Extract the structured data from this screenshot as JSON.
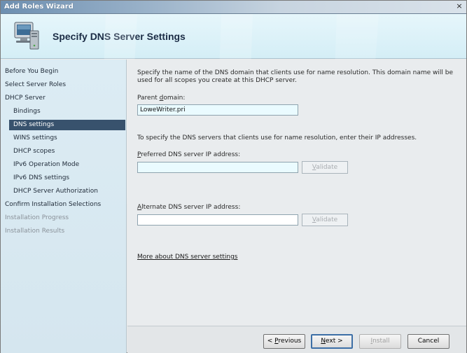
{
  "window": {
    "title": "Add Roles Wizard",
    "close_glyph": "×"
  },
  "header": {
    "title": "Specify DNS Server Settings",
    "icon": "server-computer-icon"
  },
  "sidebar": {
    "items": [
      {
        "label": "Before You Begin"
      },
      {
        "label": "Select Server Roles"
      },
      {
        "label": "DHCP Server"
      },
      {
        "label": "Bindings"
      },
      {
        "label": "DNS settings"
      },
      {
        "label": "WINS settings"
      },
      {
        "label": "DHCP scopes"
      },
      {
        "label": "IPv6 Operation Mode"
      },
      {
        "label": "IPv6 DNS settings"
      },
      {
        "label": "DHCP Server Authorization"
      },
      {
        "label": "Confirm Installation Selections"
      },
      {
        "label": "Installation Progress"
      },
      {
        "label": "Installation Results"
      }
    ]
  },
  "main": {
    "description": "Specify the name of the DNS domain that clients use for name resolution.  This domain name will be used for all scopes you create at this DHCP server.",
    "parent_domain_label_pre": "Parent ",
    "parent_domain_label_key": "d",
    "parent_domain_label_post": "omain:",
    "parent_domain_value": "LoweWriter.pri",
    "servers_instruction": "To specify the DNS servers that clients use for name resolution, enter their IP addresses.",
    "preferred_label_key": "P",
    "preferred_label_post": "referred DNS server IP address:",
    "preferred_value": "",
    "alternate_label_pre": "",
    "alternate_label_key": "A",
    "alternate_label_post": "lternate DNS server IP address:",
    "alternate_value": "",
    "validate_key": "V",
    "validate_post": "alidate",
    "more_link": "More about DNS server settings"
  },
  "footer": {
    "previous_pre": "< ",
    "previous_key": "P",
    "previous_post": "revious",
    "next_key": "N",
    "next_post": "ext >",
    "install_key": "I",
    "install_post": "nstall",
    "cancel": "Cancel"
  },
  "colors": {
    "active_nav_bg": "#38526d",
    "header_bg": "#d4eef6",
    "sidebar_bg": "#dcecf4"
  }
}
